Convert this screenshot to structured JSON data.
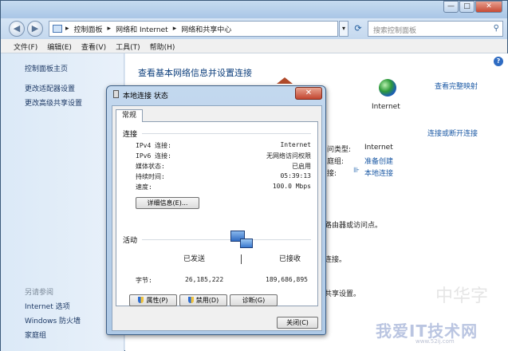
{
  "window": {
    "breadcrumbs": [
      "控制面板",
      "网络和 Internet",
      "网络和共享中心"
    ],
    "search_placeholder": "搜索控制面板",
    "buttons": {
      "minimize": "—",
      "maximize": "□",
      "close": "✕"
    }
  },
  "menu": [
    "文件(F)",
    "编辑(E)",
    "查看(V)",
    "工具(T)",
    "帮助(H)"
  ],
  "sidebar": {
    "home": "控制面板主页",
    "links": [
      "更改适配器设置",
      "更改高级共享设置"
    ],
    "see_also_label": "另请参阅",
    "see_also": [
      "Internet 选项",
      "Windows 防火墙",
      "家庭组"
    ]
  },
  "main": {
    "title": "查看基本网络信息并设置连接",
    "full_map": "查看完整映射",
    "internet_label": "Internet",
    "connect_disconnect": "连接或断开连接",
    "access_type_label": "问类型:",
    "access_type_value": "Internet",
    "homegroup_label": "庭组:",
    "homegroup_value": "准备创建",
    "connection_label": "接:",
    "connection_value": "本地连接",
    "partial_texts": [
      "路由器或访问点。",
      "连接。",
      "共享设置。"
    ]
  },
  "dialog": {
    "title": "本地连接 状态",
    "tab": "常规",
    "connection_group": "连接",
    "rows": [
      {
        "label": "IPv4 连接:",
        "value": "Internet"
      },
      {
        "label": "IPv6 连接:",
        "value": "无网络访问权限"
      },
      {
        "label": "媒体状态:",
        "value": "已启用"
      },
      {
        "label": "持续时间:",
        "value": "05:39:13"
      },
      {
        "label": "速度:",
        "value": "100.0 Mbps"
      }
    ],
    "details_button": "详细信息(E)...",
    "activity_group": "活动",
    "sent_label": "已发送",
    "received_label": "已接收",
    "bytes_label": "字节:",
    "bytes_sent": "26,185,222",
    "bytes_received": "189,686,895",
    "properties_button": "属性(P)",
    "disable_button": "禁用(D)",
    "diagnose_button": "诊断(G)",
    "close_button": "关闭(C)"
  },
  "watermark": {
    "text": "我爱IT技术网",
    "url": "www.52ij.com",
    "faint": "中华字"
  }
}
